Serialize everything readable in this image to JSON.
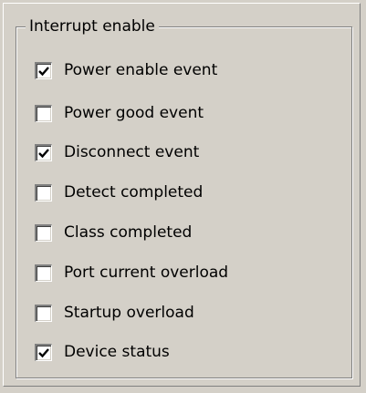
{
  "group": {
    "title": "Interrupt enable"
  },
  "options": [
    {
      "label": "Power enable event",
      "checked": true
    },
    {
      "label": "Power good event",
      "checked": false
    },
    {
      "label": "Disconnect event",
      "checked": true
    },
    {
      "label": "Detect completed",
      "checked": false
    },
    {
      "label": "Class completed",
      "checked": false
    },
    {
      "label": "Port current overload",
      "checked": false
    },
    {
      "label": "Startup overload",
      "checked": false
    },
    {
      "label": "Device status",
      "checked": true
    }
  ]
}
